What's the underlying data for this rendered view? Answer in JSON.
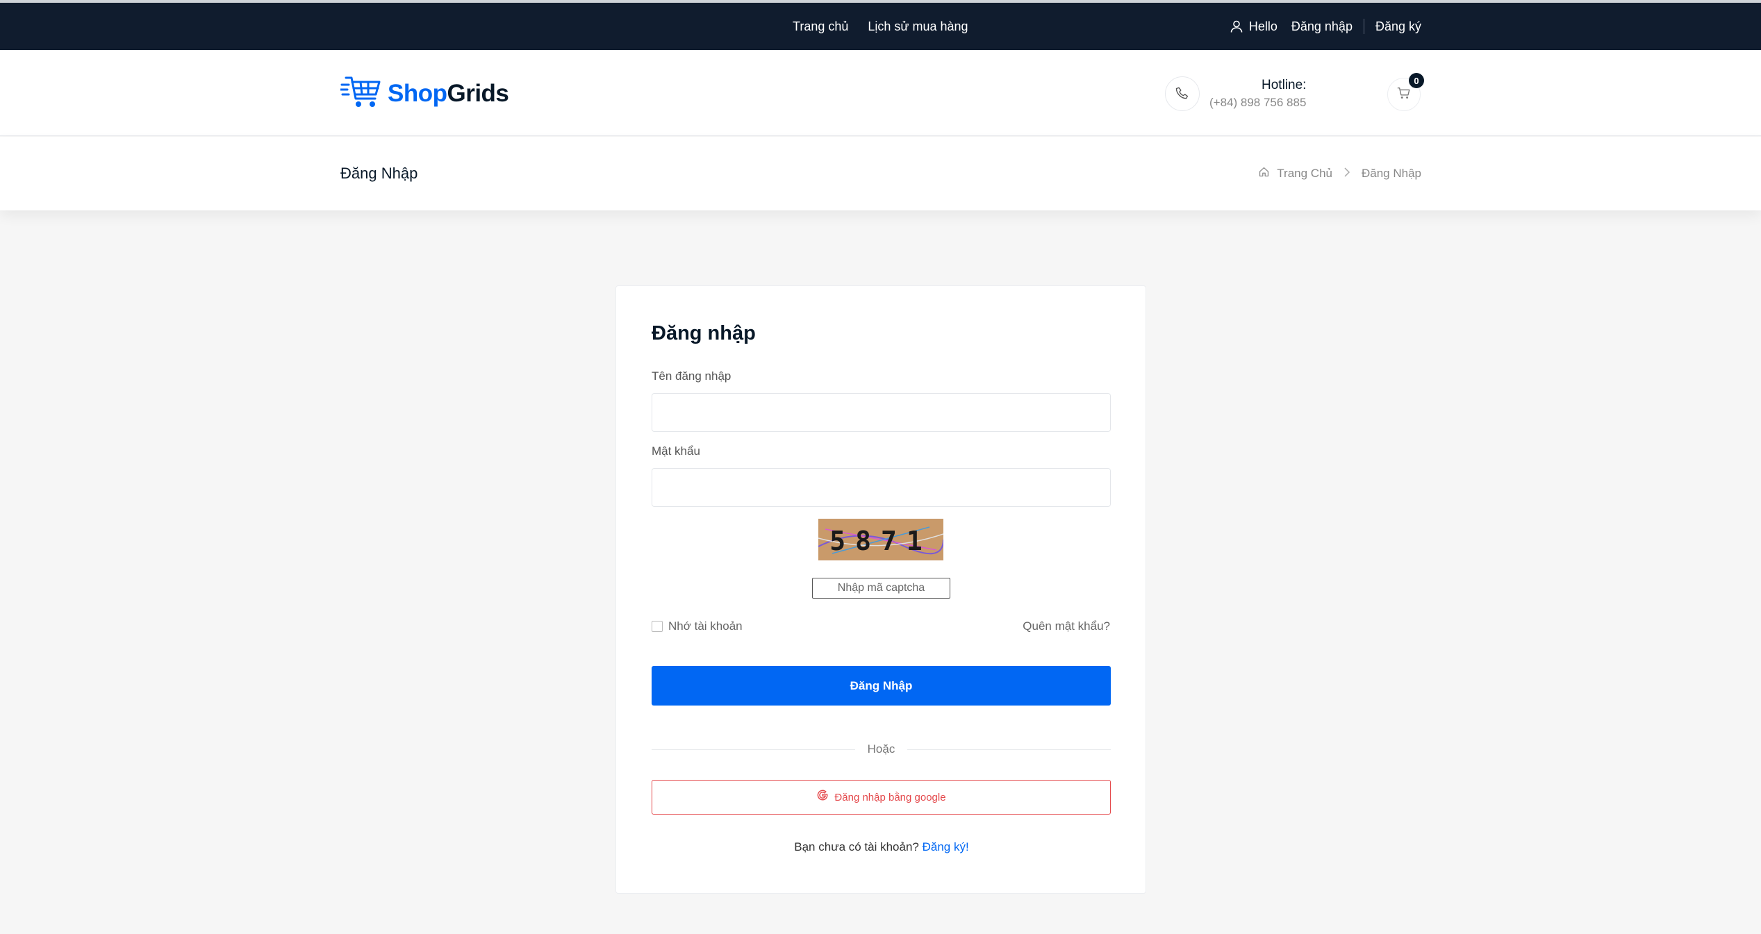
{
  "topbar": {
    "nav": [
      {
        "label": "Trang chủ"
      },
      {
        "label": "Lịch sử mua hàng"
      }
    ],
    "greeting": "Hello",
    "login_link": "Đăng nhập",
    "register_link": "Đăng ký"
  },
  "header": {
    "brand_part1": "Shop",
    "brand_part2": "Grids",
    "hotline_label": "Hotline:",
    "hotline_number": "(+84) 898 756 885",
    "cart_count": "0"
  },
  "breadcrumb": {
    "page_title": "Đăng Nhập",
    "items": [
      {
        "label": "Trang Chủ"
      },
      {
        "label": "Đăng Nhập"
      }
    ]
  },
  "login_form": {
    "title": "Đăng nhập",
    "username_label": "Tên đăng nhập",
    "username_value": "",
    "password_label": "Mật khẩu",
    "password_value": "",
    "captcha_text": "5871",
    "captcha_placeholder": "Nhập mã captcha",
    "remember_label": "Nhớ tài khoản",
    "forgot_link": "Quên mật khẩu?",
    "submit_label": "Đăng Nhập",
    "divider_text": "Hoặc",
    "google_label": "Đăng nhập bằng google",
    "signup_prompt": "Bạn chưa có tài khoản?",
    "signup_link": "Đăng ký!"
  },
  "colors": {
    "topbar_bg": "#101c2e",
    "accent": "#0167f3",
    "google_red": "#e4484b"
  }
}
